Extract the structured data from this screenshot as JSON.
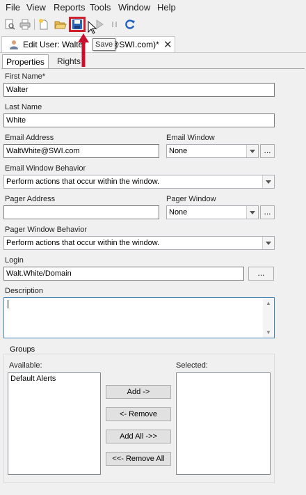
{
  "menu": [
    "File",
    "View",
    "Reports",
    "Tools",
    "Window",
    "Help"
  ],
  "toolbar": {
    "icons": [
      "print-preview-icon",
      "print-icon",
      "new-icon",
      "open-folder-icon",
      "save-icon",
      "play-icon",
      "pause-icon",
      "refresh-icon"
    ],
    "tooltip": "Save"
  },
  "document_tab": {
    "title": "Edit User: Walter White (WaltWhite@SWI.com)*",
    "visible_title": "Edit User: Walter",
    "visible_title_tail": "@SWI.com)*"
  },
  "tabs": [
    "Properties",
    "Rights"
  ],
  "form": {
    "first_name_label": "First Name*",
    "first_name": "Walter",
    "last_name_label": "Last Name",
    "last_name": "White",
    "email_label": "Email Address",
    "email": "WaltWhite@SWI.com",
    "email_window_label": "Email Window",
    "email_window": "None",
    "email_behavior_label": "Email Window Behavior",
    "email_behavior": "Perform actions that occur within the window.",
    "pager_label": "Pager Address",
    "pager": "",
    "pager_window_label": "Pager Window",
    "pager_window": "None",
    "pager_behavior_label": "Pager Window Behavior",
    "pager_behavior": "Perform actions that occur within the window.",
    "login_label": "Login",
    "login": "Walt.White/Domain",
    "description_label": "Description",
    "description": "",
    "ellipsis": "...",
    "login_ellipsis": "..."
  },
  "groups": {
    "title": "Groups",
    "available_label": "Available:",
    "selected_label": "Selected:",
    "available": [
      "Default Alerts"
    ],
    "selected": [],
    "add": "Add ->",
    "remove": "<- Remove",
    "add_all": "Add All ->>",
    "remove_all": "<<- Remove All"
  }
}
